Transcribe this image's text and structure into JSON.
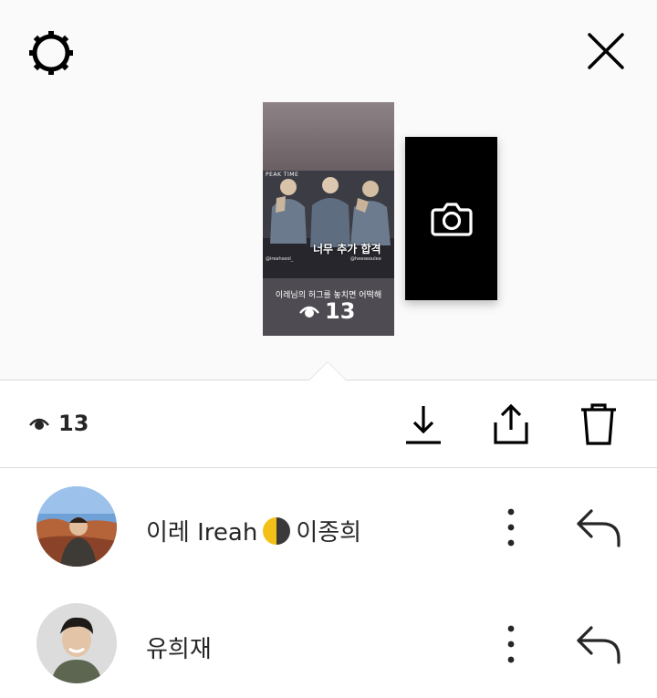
{
  "header": {
    "settings_icon": "settings-gear-icon",
    "close_icon": "close-x-icon"
  },
  "story_thumbnail": {
    "show_logo": "PEAK TIME",
    "handle_left": "@ireahseol_",
    "handle_right": "@heeseoulee",
    "caption_top": "너무 추가 합격",
    "caption_bottom": "이레님의 허그를 놓치면 어떡해",
    "view_count": "13",
    "view_icon": "eye-icon"
  },
  "camera_card": {
    "icon": "camera-icon"
  },
  "action_bar": {
    "view_icon": "eye-icon",
    "view_count": "13",
    "download_icon": "download-icon",
    "share_icon": "share-icon",
    "delete_icon": "trash-icon"
  },
  "viewers": [
    {
      "name_prefix": "이레 Ireah",
      "emoji": "first-quarter-moon",
      "name_suffix": "이종희",
      "more_icon": "more-vertical-icon",
      "reply_icon": "reply-icon"
    },
    {
      "name_prefix": "유희재",
      "more_icon": "more-vertical-icon",
      "reply_icon": "reply-icon"
    }
  ],
  "colors": {
    "top_background": "#fafafa",
    "divider": "#dbdbdb",
    "text": "#262626",
    "camera_card": "#000000"
  }
}
